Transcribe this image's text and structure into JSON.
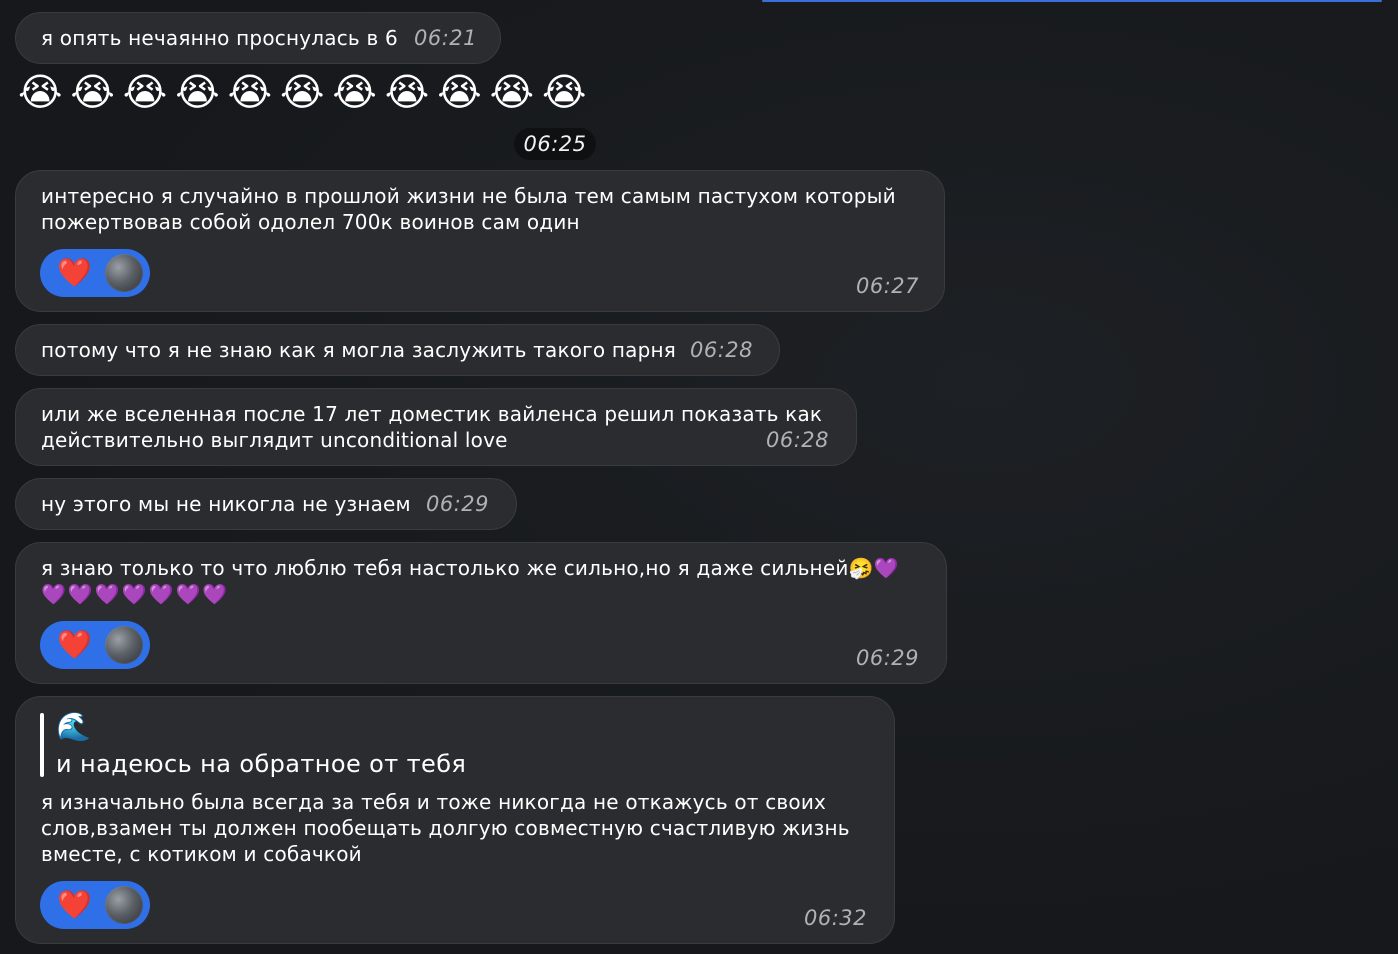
{
  "messages": [
    {
      "text": "я опять нечаянно проснулась в 6",
      "time": "06:21"
    },
    {
      "emoji": "😭😭😭😭😭😭😭😭😭😭😭"
    },
    {
      "date": "06:25"
    },
    {
      "text": "интересно я случайно в прошлой жизни не была тем самым пастухом который\nпожертвовав собой одолел 700к воинов сам один",
      "time": "06:27",
      "reaction": "heart-icon"
    },
    {
      "text": "потому что я не знаю как я могла заслужить такого парня",
      "time": "06:28"
    },
    {
      "text": "или же вселенная после 17 лет доместик вайленса решил показать как\nдействительно выглядит unconditional love",
      "time": "06:28"
    },
    {
      "text": "ну этого мы не никогла не узнаем",
      "time": "06:29"
    },
    {
      "text_line1": "я знаю только то что люблю тебя настолько же сильно,но я даже сильней🤧",
      "text_line1_purple": "💜",
      "text_line2_purple": "💜💜💜💜💜💜💜",
      "time": "06:29",
      "reaction": "heart-icon"
    },
    {
      "quote_emoji": "🌊",
      "quote_text": "и надеюсь на обратное от тебя",
      "text": "я изначально была всегда за тебя и тоже никогда не откажусь от своих\nслов,взамен ты должен пообещать долгую совместную счастливую жизнь\nвместе, с котиком и собачкой",
      "time": "06:32",
      "reaction": "heart-icon"
    }
  ],
  "reaction_heart": "❤️",
  "colors": {
    "bubble": "#2b2c2f",
    "reaction": "#2f6fe8",
    "heart": "#e8283a",
    "accent_line": "#3a6fd8"
  }
}
